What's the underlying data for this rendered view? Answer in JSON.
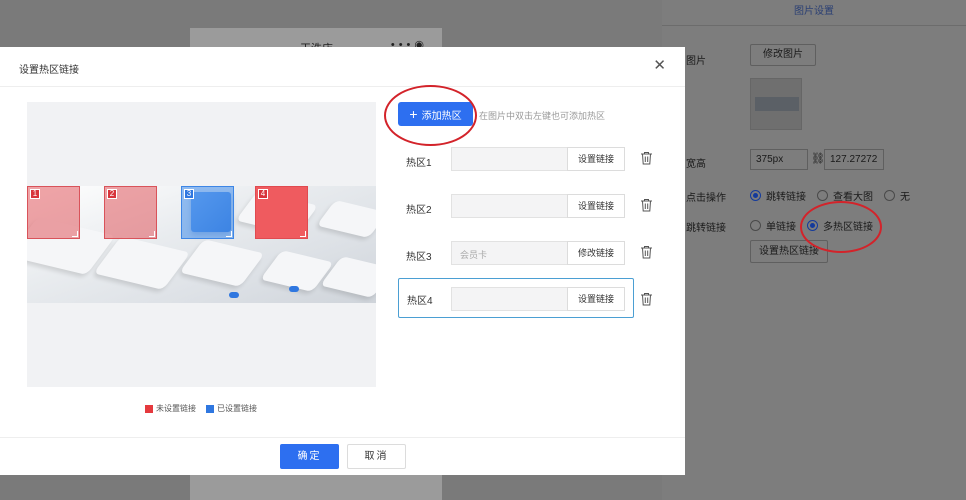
{
  "background": {
    "store_name": "干洗店",
    "right_panel": {
      "title": "图片设置",
      "image_label": "图片",
      "modify_image_button": "修改图片",
      "size_label": "宽高",
      "width_value": "375px",
      "height_value": "127.27272",
      "click_action_label": "点击操作",
      "click_options": [
        {
          "label": "跳转链接",
          "selected": true
        },
        {
          "label": "查看大图",
          "selected": false
        },
        {
          "label": "无",
          "selected": false
        }
      ],
      "jump_link_label": "跳转链接",
      "jump_options": [
        {
          "label": "单链接",
          "selected": false
        },
        {
          "label": "多热区链接",
          "selected": true
        }
      ],
      "set_hotzone_button": "设置热区链接"
    }
  },
  "modal": {
    "title": "设置热区链接",
    "add_button": "添加热区",
    "hint": "在图片中双击左键也可添加热区",
    "hotzones": [
      {
        "number": "1",
        "label": "热区1",
        "value": "",
        "placeholder": "",
        "button": "设置链接",
        "status": "unset"
      },
      {
        "number": "2",
        "label": "热区2",
        "value": "",
        "placeholder": "",
        "button": "设置链接",
        "status": "unset"
      },
      {
        "number": "3",
        "label": "热区3",
        "value": "",
        "placeholder": "会员卡",
        "button": "修改链接",
        "status": "set"
      },
      {
        "number": "4",
        "label": "热区4",
        "value": "",
        "placeholder": "",
        "button": "设置链接",
        "status": "unset"
      }
    ],
    "legend": {
      "unset": "未设置链接",
      "set": "已设置链接",
      "unset_color": "#e5393e",
      "set_color": "#2f77e0"
    },
    "ok_button": "确定",
    "cancel_button": "取消"
  },
  "colors": {
    "primary": "#2d6ff0",
    "annotation": "#d3232a"
  }
}
